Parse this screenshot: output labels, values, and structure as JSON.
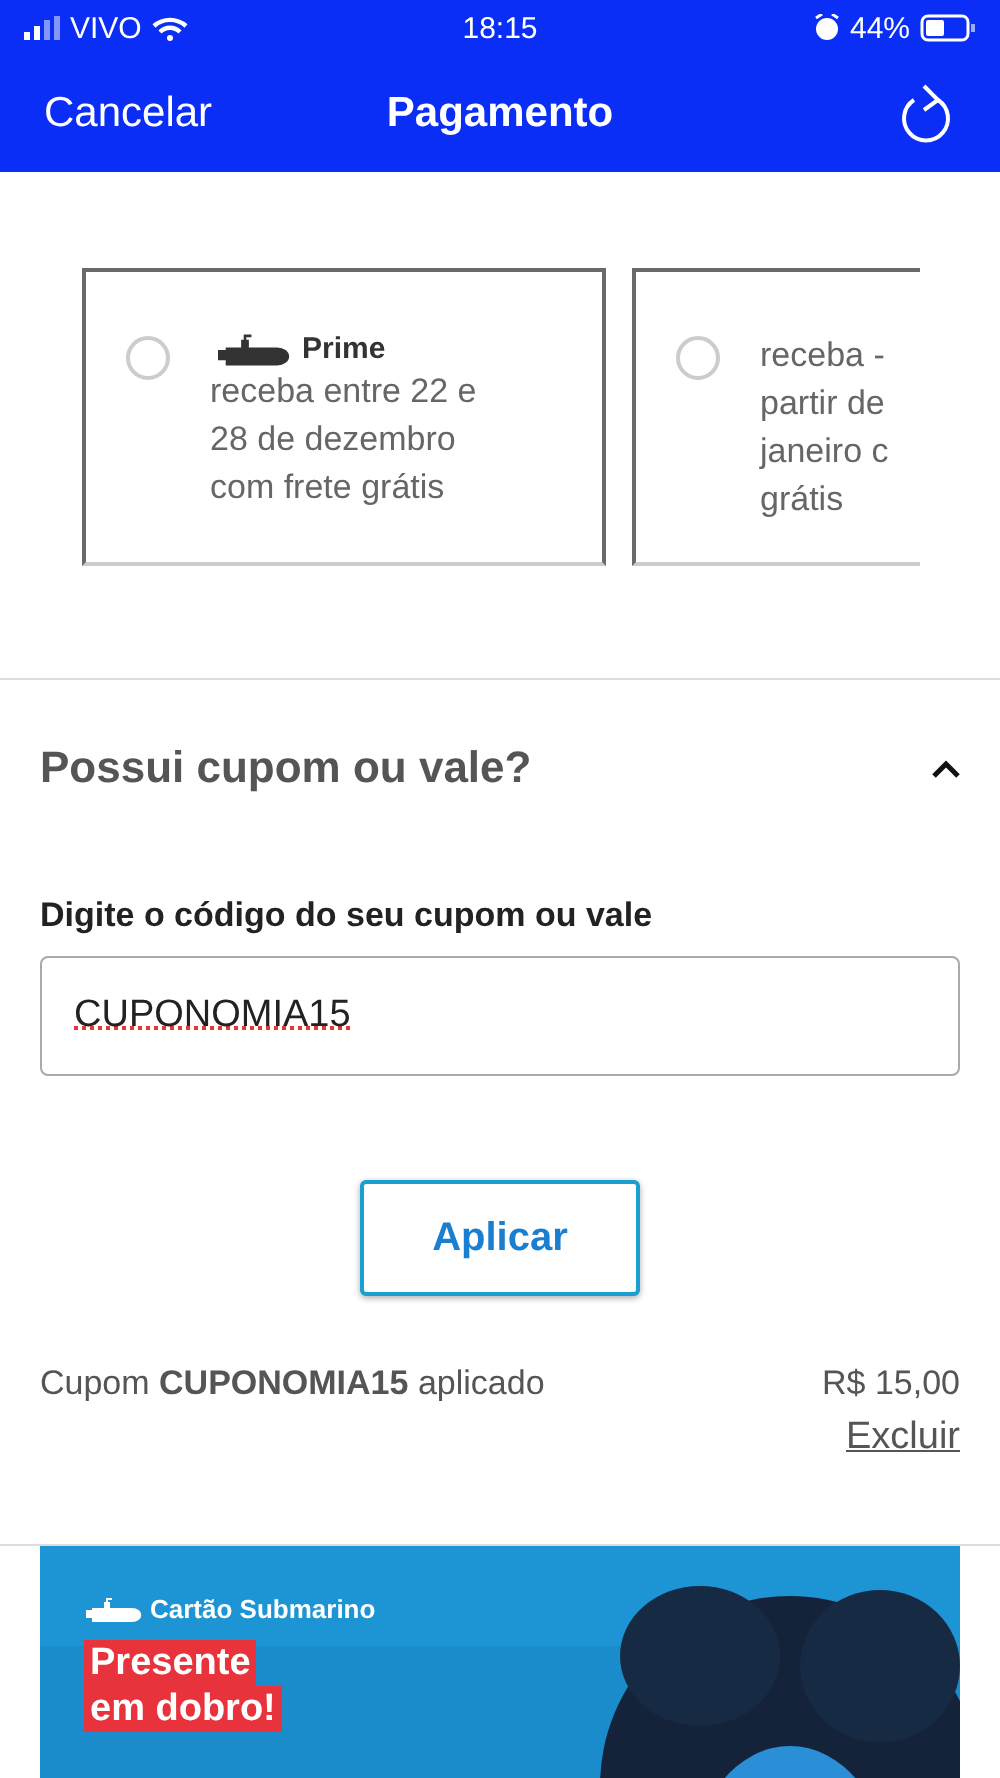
{
  "status_bar": {
    "carrier": "VIVO",
    "time": "18:15",
    "battery": "44%"
  },
  "nav_bar": {
    "cancel": "Cancelar",
    "title": "Pagamento"
  },
  "shipping_options": [
    {
      "brand": "Prime",
      "lines": [
        "receba entre 22 e",
        "28 de dezembro",
        "com frete grátis"
      ],
      "selected": false
    },
    {
      "lines": [
        "receba -",
        "partir de",
        "janeiro c",
        "grátis"
      ],
      "selected": false
    }
  ],
  "coupon": {
    "title": "Possui cupom ou vale?",
    "expanded": true,
    "label": "Digite o código do seu cupom ou vale",
    "value": "CUPONOMIA15",
    "button": "Aplicar",
    "applied_text": "Cupom **CUPONOMIA15** aplicado",
    "amount": "R$ 15,00",
    "remove": "Excluir"
  },
  "banner": {
    "brand": "Cartão Submarino",
    "headline": [
      "Presente",
      "em dobro!"
    ]
  }
}
